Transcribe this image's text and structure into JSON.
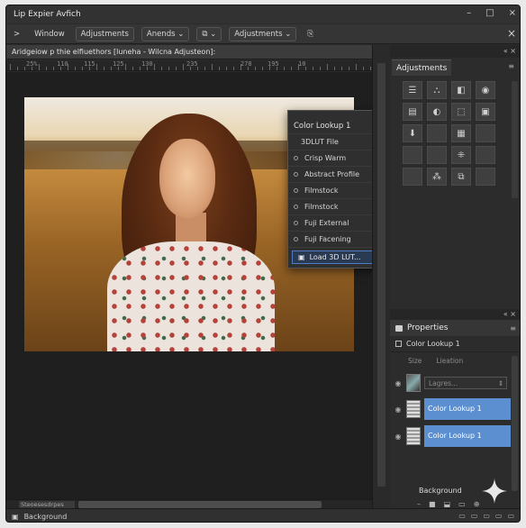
{
  "window": {
    "title": "Lip  Expier Avfich",
    "controls": [
      "–",
      "□",
      "×"
    ]
  },
  "menubar": {
    "items": [
      {
        "label": "Window",
        "type": "text"
      },
      {
        "label": "Adjustments",
        "type": "button"
      },
      {
        "label": "Anends",
        "type": "dropdown"
      },
      {
        "label": "Adjustments",
        "type": "dropdown"
      }
    ],
    "close_label": "×"
  },
  "document": {
    "tab_label": "Aridgeiow p thie elfiuethors [luneha - Wilcna Adjusteon]:",
    "ruler_labels": [
      "25%",
      "110",
      "115",
      "125",
      "130",
      "235",
      "278",
      "195",
      "10"
    ]
  },
  "lut_panel": {
    "header_controls": "= ×",
    "title": "Color Lookup 1",
    "file_label": "3DLUT File",
    "items": [
      {
        "label": "Crisp Warm",
        "has_submenu": true
      },
      {
        "label": "Abstract Profile",
        "has_submenu": true
      },
      {
        "label": "Filmstock",
        "has_submenu": false
      },
      {
        "label": "Filmstock",
        "has_submenu": true
      },
      {
        "label": "Fuji External",
        "has_submenu": true
      },
      {
        "label": "Fuji Facening",
        "has_submenu": false
      }
    ],
    "load_label": "Load 3D LUT..."
  },
  "adjustments": {
    "panel_controls": "« ×",
    "tab_label": "Adjustments",
    "menu": "≡",
    "icons": [
      "☰",
      "⛬",
      "◧",
      "◉",
      "▤",
      "◐",
      "⬚",
      "▣",
      "⬇",
      "",
      "▦",
      "",
      "",
      "",
      "⁜",
      "",
      "",
      "⁂",
      "⧉",
      ""
    ]
  },
  "properties": {
    "panel_controls": "« ×",
    "tab_label": "Properties",
    "menu": "≡",
    "sub_label": "Color Lookup 1",
    "columns": [
      "Size",
      "Lieation"
    ],
    "layers": [
      {
        "type": "field",
        "placeholder": "Lagres..."
      },
      {
        "type": "layer",
        "name": "Color Lookup 1"
      },
      {
        "type": "layer",
        "name": "Color Lookup 1"
      }
    ],
    "background_label": "Background",
    "bottom_icons": [
      "–",
      "■",
      "⬓",
      "▭",
      "⊕"
    ]
  },
  "canvas": {
    "scroll_tag": "Steoesesdrpes"
  },
  "status": {
    "label": "Background",
    "icons": [
      "▭",
      "▭",
      "▭",
      "▭",
      "▭"
    ]
  },
  "colors": {
    "accent": "#5b8fd0",
    "panel": "#2c2c2c",
    "canvas": "#1f1f1f"
  }
}
